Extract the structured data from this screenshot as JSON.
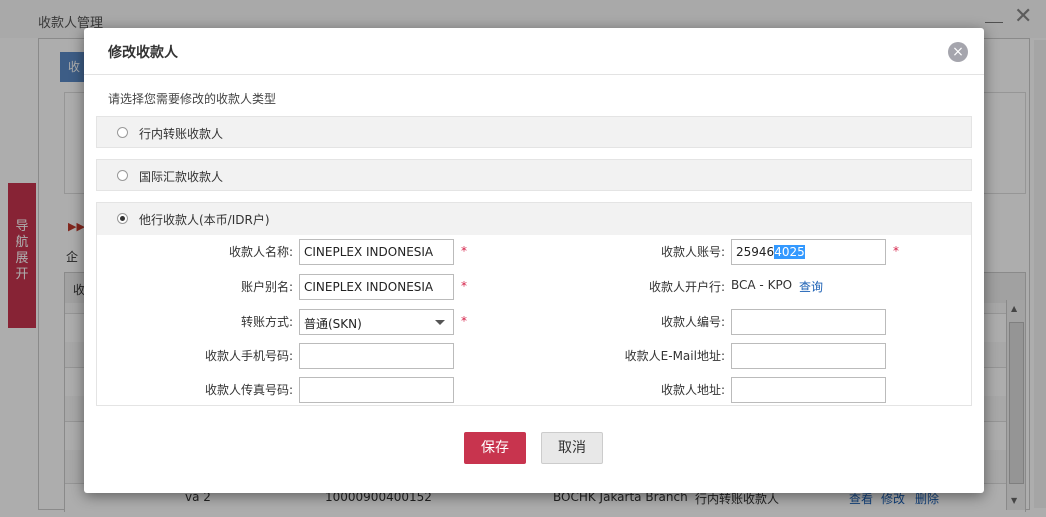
{
  "background": {
    "window_title": "收款人管理",
    "close_glyph": "✕",
    "tab_label": "收",
    "arrows": "▶▶",
    "company_label": "企",
    "grid_header_label": "收",
    "nav_tab": [
      "导",
      "航",
      "展",
      "开"
    ],
    "visible_row": {
      "name": "va 2",
      "account": "10000900400152",
      "bank": "BOCHK Jakarta Branch",
      "type": "行内转账收款人",
      "view": "查看",
      "edit": "修改",
      "delete": "删除"
    }
  },
  "modal": {
    "title": "修改收款人",
    "close_icon": "×",
    "prompt": "请选择您需要修改的收款人类型",
    "options": [
      {
        "label": "行内转账收款人",
        "checked": false
      },
      {
        "label": "国际汇款收款人",
        "checked": false
      },
      {
        "label": "他行收款人(本币/IDR户)",
        "checked": true
      }
    ],
    "form": {
      "payee_name_label": "收款人名称:",
      "payee_name_value": "CINEPLEX INDONESIA",
      "alias_label": "账户别名:",
      "alias_value": "CINEPLEX INDONESIA",
      "transfer_method_label": "转账方式:",
      "transfer_method_value": "普通(SKN)",
      "mobile_label": "收款人手机号码:",
      "mobile_value": "",
      "fax_label": "收款人传真号码:",
      "fax_value": "",
      "account_label": "收款人账号:",
      "account_value_plain": "25946",
      "account_value_selected": "4025",
      "bank_label": "收款人开户行:",
      "bank_value": "BCA - KPO",
      "bank_query_link": "查询",
      "payee_code_label": "收款人编号:",
      "payee_code_value": "",
      "email_label": "收款人E-Mail地址:",
      "email_value": "",
      "address_label": "收款人地址:",
      "address_value": "",
      "required_mark": "*"
    },
    "buttons": {
      "save": "保存",
      "cancel": "取消"
    }
  }
}
